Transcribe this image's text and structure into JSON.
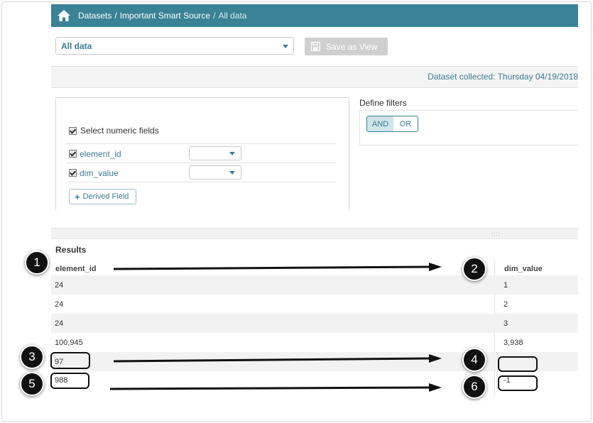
{
  "breadcrumb": {
    "home_icon": "home-icon",
    "datasets": "Datasets",
    "separator": "/",
    "source": "Important Smart Source",
    "current": "All data"
  },
  "view_select": {
    "value": "All data"
  },
  "save_view": {
    "label": "Save as View",
    "icon": "floppy-disk-icon"
  },
  "collected": {
    "text": "Dataset collected: Thursday 04/19/2018"
  },
  "fields": {
    "select_numeric_label": "Select numeric fields",
    "items": [
      {
        "name": "element_id",
        "checked": true
      },
      {
        "name": "dim_value",
        "checked": true
      }
    ],
    "derived_label": "Derived Field"
  },
  "filters": {
    "title": "Define filters",
    "and_label": "AND",
    "or_label": "OR"
  },
  "results": {
    "title": "Results",
    "columns": [
      "element_id",
      "dim_value"
    ],
    "rows": [
      [
        "24",
        "1"
      ],
      [
        "24",
        "2"
      ],
      [
        "24",
        "3"
      ],
      [
        "100,945",
        "3,938"
      ],
      [
        "97",
        ""
      ],
      [
        "988",
        "-1"
      ]
    ]
  },
  "callouts": [
    "1",
    "2",
    "3",
    "4",
    "5",
    "6"
  ],
  "colors": {
    "header_bar": "#3a8296",
    "accent": "#3a7d92",
    "disabled_button": "#cfcfcf"
  }
}
